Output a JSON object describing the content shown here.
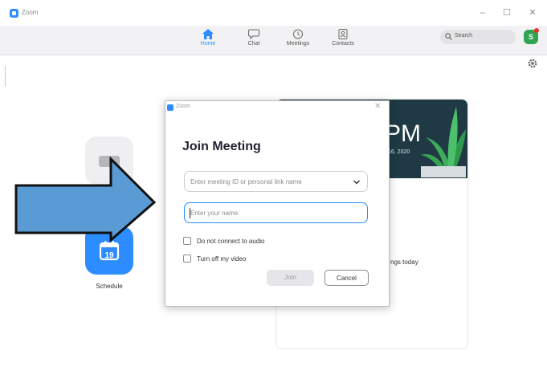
{
  "window": {
    "app_title": "Zoom",
    "minimize_glyph": "–",
    "maximize_glyph": "☐",
    "close_glyph": "✕"
  },
  "nav": {
    "tabs": [
      {
        "label": "Home",
        "icon": "home-icon",
        "active": true
      },
      {
        "label": "Chat",
        "icon": "chat-icon",
        "active": false
      },
      {
        "label": "Meetings",
        "icon": "clock-icon",
        "active": false
      },
      {
        "label": "Contacts",
        "icon": "contacts-icon",
        "active": false
      }
    ],
    "search_placeholder": "Search",
    "avatar_initial": "S"
  },
  "home": {
    "schedule_label": "Schedule",
    "schedule_day": "19"
  },
  "calendar": {
    "time": "PM",
    "date": "16, 2020",
    "no_meetings": "ngs today"
  },
  "dialog": {
    "app_title": "Zoom",
    "close_glyph": "✕",
    "title": "Join Meeting",
    "meeting_id_placeholder": "Enter meeting ID or personal link name",
    "name_placeholder": "Enter your name",
    "options": [
      {
        "label": "Do not connect to audio",
        "checked": false
      },
      {
        "label": "Turn off my video",
        "checked": false
      }
    ],
    "join_label": "Join",
    "cancel_label": "Cancel"
  },
  "colors": {
    "accent": "#2d8cff",
    "annotation_arrow": "#5b9bd5",
    "banner": "#1f3a45"
  }
}
